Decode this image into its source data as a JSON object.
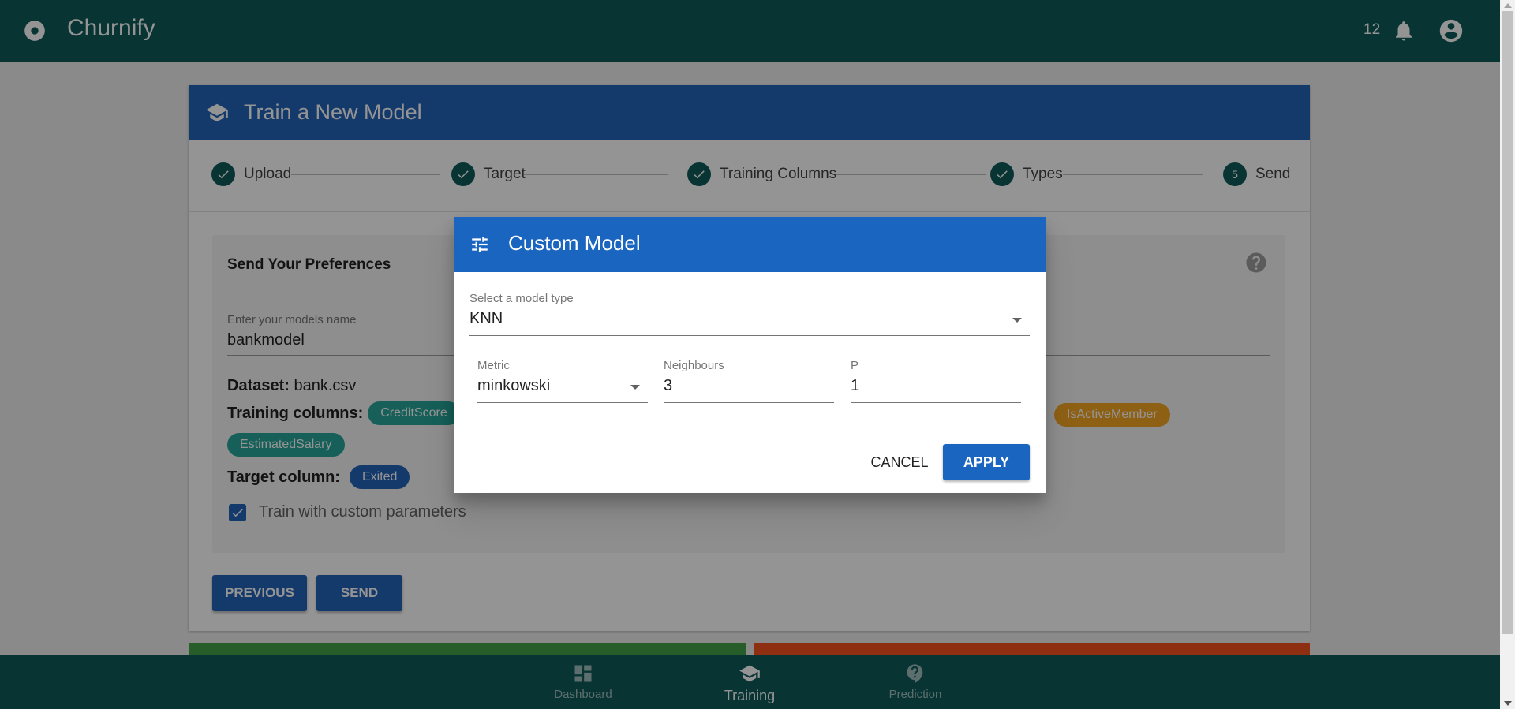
{
  "app": {
    "title": "Churnify",
    "notification_count": "12"
  },
  "card": {
    "title": "Train a New Model"
  },
  "stepper": {
    "steps": [
      {
        "label": "Upload",
        "state": "done"
      },
      {
        "label": "Target",
        "state": "done"
      },
      {
        "label": "Training Columns",
        "state": "done"
      },
      {
        "label": "Types",
        "state": "done"
      },
      {
        "label": "Send",
        "number": "5",
        "state": "active"
      }
    ]
  },
  "preferences": {
    "title": "Send Your Preferences",
    "name_label": "Enter your models name",
    "name_value": "bankmodel",
    "dataset_label": "Dataset:",
    "dataset_value": "bank.csv",
    "training_label": "Training columns:",
    "training_chips": [
      "CreditScore",
      "IsActiveMember",
      "EstimatedSalary"
    ],
    "target_label": "Target column:",
    "target_chip": "Exited",
    "custom_label": "Train with custom parameters",
    "custom_checked": true
  },
  "buttons": {
    "previous": "PREVIOUS",
    "send": "SEND"
  },
  "dialog": {
    "title": "Custom Model",
    "model_type_label": "Select a model type",
    "model_type_value": "KNN",
    "metric_label": "Metric",
    "metric_value": "minkowski",
    "neighbours_label": "Neighbours",
    "neighbours_value": "3",
    "p_label": "P",
    "p_value": "1",
    "cancel": "CANCEL",
    "apply": "APPLY"
  },
  "nav": {
    "dashboard": "Dashboard",
    "training": "Training",
    "prediction": "Prediction",
    "active": "Training"
  },
  "colors": {
    "appbar": "#0f5a5a",
    "primary": "#2462b8",
    "chip_teal": "#26a69a",
    "chip_orange": "#f5a623"
  }
}
